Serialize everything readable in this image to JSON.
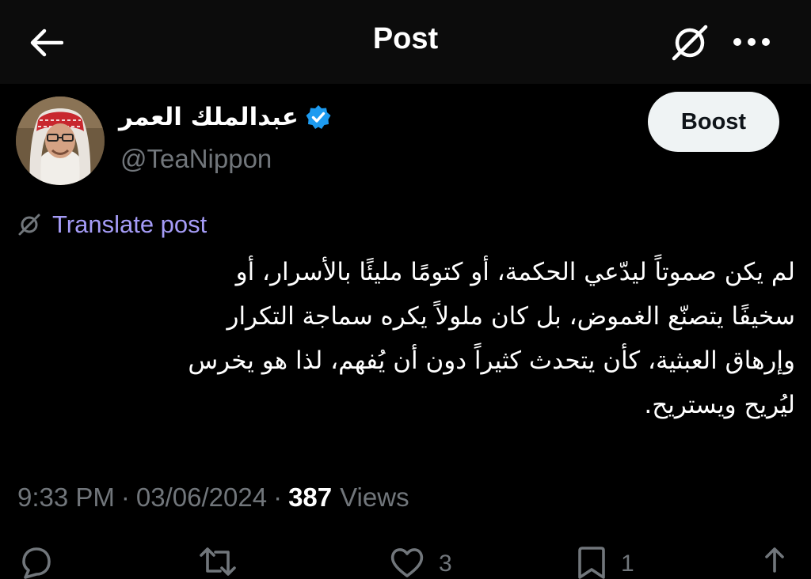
{
  "header": {
    "title": "Post",
    "back_icon": "arrow-left-icon",
    "grok_icon": "grok-icon",
    "more_icon": "more-horizontal-icon"
  },
  "author": {
    "name": "عبدالملك العمر",
    "handle": "@TeaNippon",
    "verified": true,
    "verified_color": "#1d9bf0"
  },
  "boost": {
    "label": "Boost"
  },
  "translate": {
    "label": "Translate post",
    "color": "#a59cf7"
  },
  "post": {
    "lines": [
      "لم يكن صموتاً ليدّعي الحكمة، أو كتومًا مليئًا بالأسرار، أو",
      "سخيفًا يتصنّع الغموض، بل كان ملولاً يكره سماجة التكرار",
      "وإرهاق العبثية، كأن يتحدث كثيراً دون أن يُفهم، لذا هو يخرس",
      "ليُريح ويستريح."
    ]
  },
  "meta": {
    "time": "9:33 PM",
    "date": "03/06/2024",
    "separator": "·",
    "views_count": "387",
    "views_label": "Views"
  },
  "actions": {
    "reply_icon": "reply-icon",
    "repost_icon": "repost-icon",
    "like_icon": "heart-icon",
    "like_count": "3",
    "bookmark_icon": "bookmark-icon",
    "bookmark_count": "1",
    "share_icon": "share-icon"
  },
  "colors": {
    "background": "#000000",
    "header_background": "#0c0c0c",
    "secondary_text": "#71767b",
    "primary_text": "#ffffff"
  }
}
